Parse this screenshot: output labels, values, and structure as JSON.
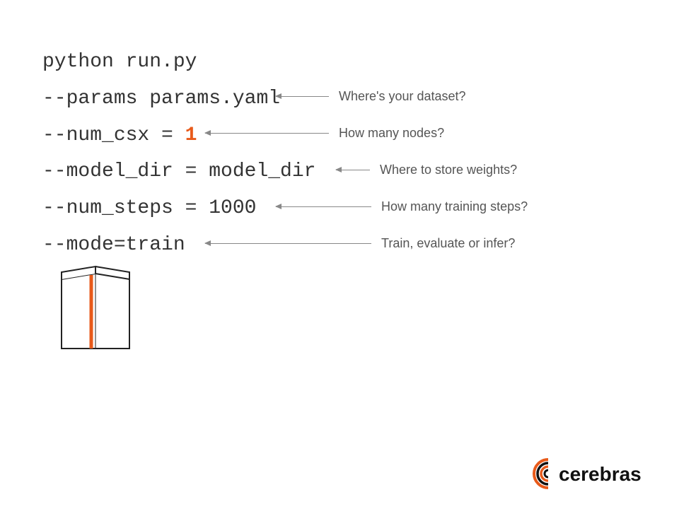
{
  "code": {
    "line0": "python run.py",
    "line1": "--params params.yaml",
    "line2_pre": "--num_csx = ",
    "line2_val": "1",
    "line3": "--model_dir = model_dir",
    "line4": "--num_steps = 1000",
    "line5": "--mode=train"
  },
  "annotations": {
    "a1": "Where's your dataset?",
    "a2": "How many nodes?",
    "a3": "Where to store weights?",
    "a4": "How many training steps?",
    "a5": "Train, evaluate or infer?"
  },
  "logo_text": "cerebras",
  "colors": {
    "accent": "#e85a1a"
  }
}
